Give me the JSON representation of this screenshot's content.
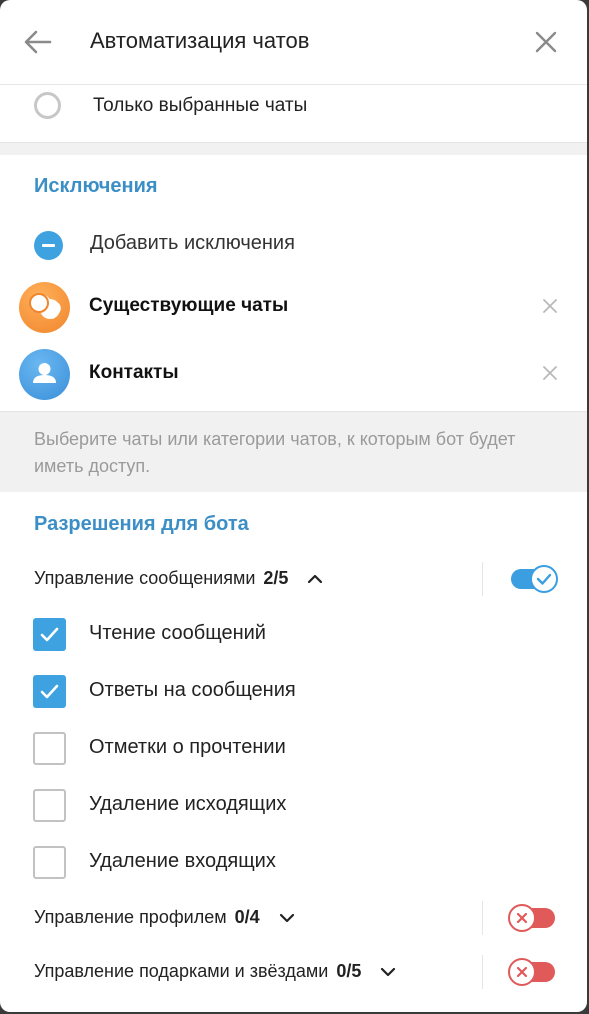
{
  "header": {
    "title": "Автоматизация чатов"
  },
  "radio_option": {
    "label": "Только выбранные чаты",
    "selected": false
  },
  "exceptions": {
    "title": "Исключения",
    "add_label": "Добавить исключения",
    "items": [
      {
        "label": "Существующие чаты",
        "icon": "chats-icon",
        "color": "#f0852c"
      },
      {
        "label": "Контакты",
        "icon": "user-icon",
        "color": "#3a8fd8"
      }
    ],
    "note": "Выберите чаты или категории чатов, к которым бот будет иметь доступ."
  },
  "permissions": {
    "title": "Разрешения для бота",
    "groups": [
      {
        "label": "Управление сообщениями",
        "count": "2/5",
        "expanded": true,
        "enabled": true,
        "items": [
          {
            "label": "Чтение сообщений",
            "checked": true
          },
          {
            "label": "Ответы на сообщения",
            "checked": true
          },
          {
            "label": "Отметки о прочтении",
            "checked": false
          },
          {
            "label": "Удаление исходящих",
            "checked": false
          },
          {
            "label": "Удаление входящих",
            "checked": false
          }
        ]
      },
      {
        "label": "Управление профилем",
        "count": "0/4",
        "expanded": false,
        "enabled": false
      },
      {
        "label": "Управление подарками и звёздами",
        "count": "0/5",
        "expanded": false,
        "enabled": false
      }
    ]
  },
  "colors": {
    "accent": "#3a9ee0",
    "section_title": "#3c8fc6",
    "toggle_off": "#e05a5a"
  }
}
